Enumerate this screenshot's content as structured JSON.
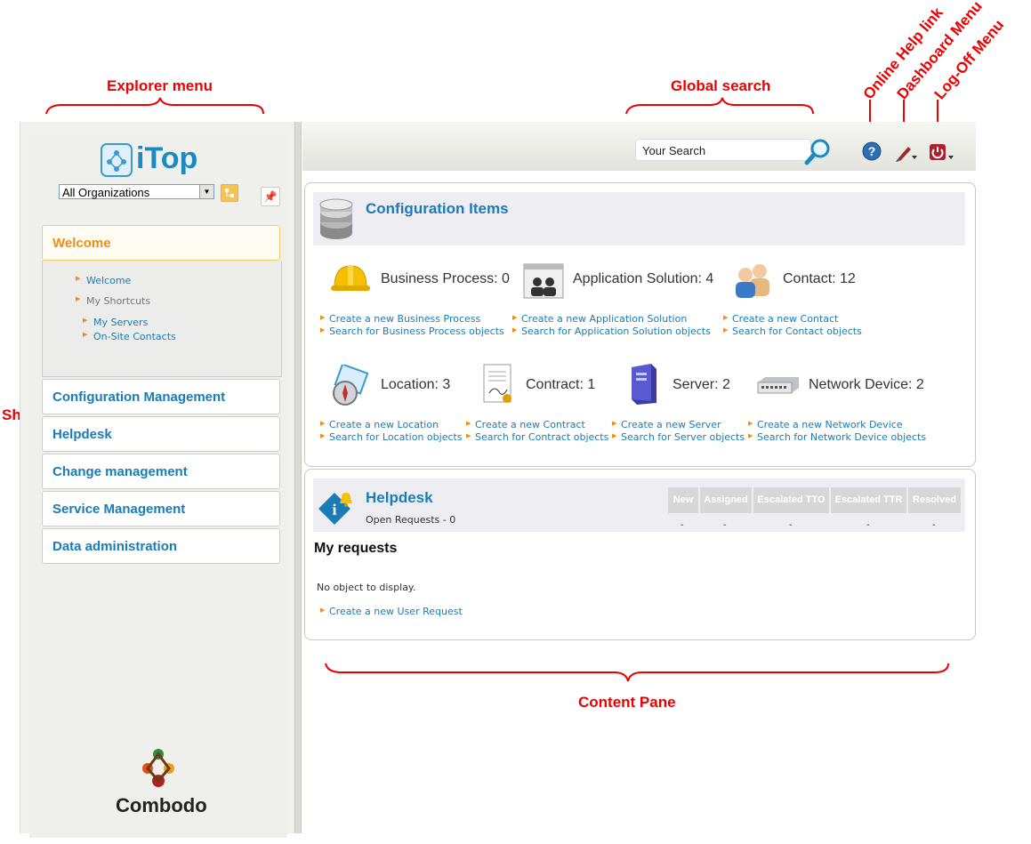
{
  "annotations": {
    "explorer_menu": "Explorer menu",
    "global_search": "Global search",
    "online_help": "Online Help link",
    "dashboard_menu": "Dashboard Menu",
    "log_off_menu": "Log-Off Menu",
    "shortcuts": "Shortcuts",
    "content_pane": "Content Pane"
  },
  "sidebar": {
    "logo_text": "iTop",
    "org_select": "All Organizations",
    "welcome_header": "Welcome",
    "welcome_link": "Welcome",
    "my_shortcuts": "My Shortcuts",
    "shortcuts": [
      "My Servers",
      "On-Site Contacts"
    ],
    "menus": [
      "Configuration Management",
      "Helpdesk",
      "Change management",
      "Service Management",
      "Data administration"
    ],
    "footer_logo": "Combodo"
  },
  "topbar": {
    "search_value": "Your Search"
  },
  "ci_panel": {
    "title": "Configuration Items",
    "items": [
      {
        "label": "Business Process: 0",
        "create": "Create a new Business Process",
        "search": "Search for Business Process objects"
      },
      {
        "label": "Application Solution: 4",
        "create": "Create a new Application Solution",
        "search": "Search for Application Solution objects"
      },
      {
        "label": "Contact: 12",
        "create": "Create a new Contact",
        "search": "Search for Contact objects"
      },
      {
        "label": "Location: 3",
        "create": "Create a new Location",
        "search": "Search for Location objects"
      },
      {
        "label": "Contract: 1",
        "create": "Create a new Contract",
        "search": "Search for Contract objects"
      },
      {
        "label": "Server: 2",
        "create": "Create a new Server",
        "search": "Search for Server objects"
      },
      {
        "label": "Network Device: 2",
        "create": "Create a new Network Device",
        "search": "Search for Network Device objects"
      }
    ]
  },
  "helpdesk_panel": {
    "title": "Helpdesk",
    "subtitle": "Open Requests - 0",
    "columns": [
      "New",
      "Assigned",
      "Escalated TTO",
      "Escalated TTR",
      "Resolved"
    ],
    "values": [
      "-",
      "-",
      "-",
      "-",
      "-"
    ],
    "my_requests": "My requests",
    "empty": "No object to display.",
    "create_link": "Create a new User Request"
  },
  "colors": {
    "accent": "#1a7bb6",
    "orange": "#ef8d16",
    "annotation": "#e00000"
  }
}
